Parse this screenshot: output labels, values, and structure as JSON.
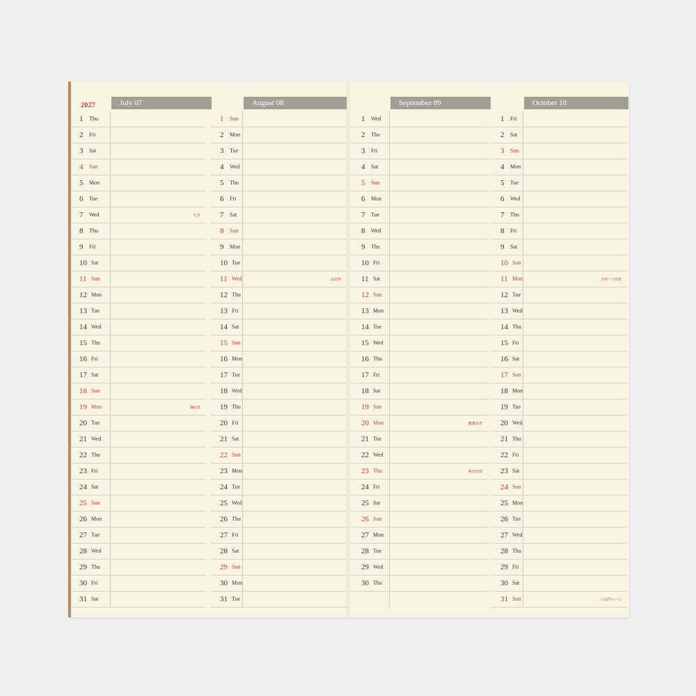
{
  "year": "2027",
  "months": [
    {
      "name": "July 07",
      "days": [
        {
          "n": "1",
          "w": "Thu"
        },
        {
          "n": "2",
          "w": "Fri"
        },
        {
          "n": "3",
          "w": "Sat"
        },
        {
          "n": "4",
          "w": "Sun",
          "red": true
        },
        {
          "n": "5",
          "w": "Mon"
        },
        {
          "n": "6",
          "w": "Tue"
        },
        {
          "n": "7",
          "w": "Wed",
          "note": "七夕"
        },
        {
          "n": "8",
          "w": "Thu"
        },
        {
          "n": "9",
          "w": "Fri"
        },
        {
          "n": "10",
          "w": "Sat"
        },
        {
          "n": "11",
          "w": "Sun",
          "red": true
        },
        {
          "n": "12",
          "w": "Mon"
        },
        {
          "n": "13",
          "w": "Tue"
        },
        {
          "n": "14",
          "w": "Wed"
        },
        {
          "n": "15",
          "w": "Thu"
        },
        {
          "n": "16",
          "w": "Fri"
        },
        {
          "n": "17",
          "w": "Sat"
        },
        {
          "n": "18",
          "w": "Sun",
          "red": true
        },
        {
          "n": "19",
          "w": "Mon",
          "red": true,
          "note": "海の日"
        },
        {
          "n": "20",
          "w": "Tue"
        },
        {
          "n": "21",
          "w": "Wed"
        },
        {
          "n": "22",
          "w": "Thu"
        },
        {
          "n": "23",
          "w": "Fri"
        },
        {
          "n": "24",
          "w": "Sat"
        },
        {
          "n": "25",
          "w": "Sun",
          "red": true
        },
        {
          "n": "26",
          "w": "Mon"
        },
        {
          "n": "27",
          "w": "Tue"
        },
        {
          "n": "28",
          "w": "Wed"
        },
        {
          "n": "29",
          "w": "Thu"
        },
        {
          "n": "30",
          "w": "Fri"
        },
        {
          "n": "31",
          "w": "Sat"
        }
      ]
    },
    {
      "name": "August 08",
      "days": [
        {
          "n": "1",
          "w": "Sun",
          "red": true
        },
        {
          "n": "2",
          "w": "Mon"
        },
        {
          "n": "3",
          "w": "Tue"
        },
        {
          "n": "4",
          "w": "Wed"
        },
        {
          "n": "5",
          "w": "Thu"
        },
        {
          "n": "6",
          "w": "Fri"
        },
        {
          "n": "7",
          "w": "Sat"
        },
        {
          "n": "8",
          "w": "Sun",
          "red": true
        },
        {
          "n": "9",
          "w": "Mon"
        },
        {
          "n": "10",
          "w": "Tue"
        },
        {
          "n": "11",
          "w": "Wed",
          "red": true,
          "note": "山の日"
        },
        {
          "n": "12",
          "w": "Thu"
        },
        {
          "n": "13",
          "w": "Fri"
        },
        {
          "n": "14",
          "w": "Sat"
        },
        {
          "n": "15",
          "w": "Sun",
          "red": true
        },
        {
          "n": "16",
          "w": "Mon"
        },
        {
          "n": "17",
          "w": "Tue"
        },
        {
          "n": "18",
          "w": "Wed"
        },
        {
          "n": "19",
          "w": "Thu"
        },
        {
          "n": "20",
          "w": "Fri"
        },
        {
          "n": "21",
          "w": "Sat"
        },
        {
          "n": "22",
          "w": "Sun",
          "red": true
        },
        {
          "n": "23",
          "w": "Mon"
        },
        {
          "n": "24",
          "w": "Tue"
        },
        {
          "n": "25",
          "w": "Wed"
        },
        {
          "n": "26",
          "w": "Thu"
        },
        {
          "n": "27",
          "w": "Fri"
        },
        {
          "n": "28",
          "w": "Sat"
        },
        {
          "n": "29",
          "w": "Sun",
          "red": true
        },
        {
          "n": "30",
          "w": "Mon"
        },
        {
          "n": "31",
          "w": "Tue"
        }
      ]
    },
    {
      "name": "September 09",
      "days": [
        {
          "n": "1",
          "w": "Wed"
        },
        {
          "n": "2",
          "w": "Thu"
        },
        {
          "n": "3",
          "w": "Fri"
        },
        {
          "n": "4",
          "w": "Sat"
        },
        {
          "n": "5",
          "w": "Sun",
          "red": true
        },
        {
          "n": "6",
          "w": "Mon"
        },
        {
          "n": "7",
          "w": "Tue"
        },
        {
          "n": "8",
          "w": "Wed"
        },
        {
          "n": "9",
          "w": "Thu"
        },
        {
          "n": "10",
          "w": "Fri"
        },
        {
          "n": "11",
          "w": "Sat"
        },
        {
          "n": "12",
          "w": "Sun",
          "red": true
        },
        {
          "n": "13",
          "w": "Mon"
        },
        {
          "n": "14",
          "w": "Tue"
        },
        {
          "n": "15",
          "w": "Wed"
        },
        {
          "n": "16",
          "w": "Thu"
        },
        {
          "n": "17",
          "w": "Fri"
        },
        {
          "n": "18",
          "w": "Sat"
        },
        {
          "n": "19",
          "w": "Sun",
          "red": true
        },
        {
          "n": "20",
          "w": "Mon",
          "red": true,
          "note": "敬老の日"
        },
        {
          "n": "21",
          "w": "Tue"
        },
        {
          "n": "22",
          "w": "Wed"
        },
        {
          "n": "23",
          "w": "Thu",
          "red": true,
          "note": "秋分の日"
        },
        {
          "n": "24",
          "w": "Fri"
        },
        {
          "n": "25",
          "w": "Sat"
        },
        {
          "n": "26",
          "w": "Sun",
          "red": true
        },
        {
          "n": "27",
          "w": "Mon"
        },
        {
          "n": "28",
          "w": "Tue"
        },
        {
          "n": "29",
          "w": "Wed"
        },
        {
          "n": "30",
          "w": "Thu"
        }
      ]
    },
    {
      "name": "October 10",
      "days": [
        {
          "n": "1",
          "w": "Fri"
        },
        {
          "n": "2",
          "w": "Sat"
        },
        {
          "n": "3",
          "w": "Sun",
          "red": true
        },
        {
          "n": "4",
          "w": "Mon"
        },
        {
          "n": "5",
          "w": "Tue"
        },
        {
          "n": "6",
          "w": "Wed"
        },
        {
          "n": "7",
          "w": "Thu"
        },
        {
          "n": "8",
          "w": "Fri"
        },
        {
          "n": "9",
          "w": "Sat"
        },
        {
          "n": "10",
          "w": "Sun",
          "red": true
        },
        {
          "n": "11",
          "w": "Mon",
          "red": true,
          "note": "スポーツの日"
        },
        {
          "n": "12",
          "w": "Tue"
        },
        {
          "n": "13",
          "w": "Wed"
        },
        {
          "n": "14",
          "w": "Thu"
        },
        {
          "n": "15",
          "w": "Fri"
        },
        {
          "n": "16",
          "w": "Sat"
        },
        {
          "n": "17",
          "w": "Sun",
          "red": true
        },
        {
          "n": "18",
          "w": "Mon"
        },
        {
          "n": "19",
          "w": "Tue"
        },
        {
          "n": "20",
          "w": "Wed"
        },
        {
          "n": "21",
          "w": "Thu"
        },
        {
          "n": "22",
          "w": "Fri"
        },
        {
          "n": "23",
          "w": "Sat"
        },
        {
          "n": "24",
          "w": "Sun",
          "red": true
        },
        {
          "n": "25",
          "w": "Mon"
        },
        {
          "n": "26",
          "w": "Tue"
        },
        {
          "n": "27",
          "w": "Wed"
        },
        {
          "n": "28",
          "w": "Thu"
        },
        {
          "n": "29",
          "w": "Fri"
        },
        {
          "n": "30",
          "w": "Sat"
        },
        {
          "n": "31",
          "w": "Sun",
          "red": true,
          "note": "ハロウィーン",
          "noteGrey": false
        }
      ]
    }
  ],
  "colors": {
    "accent_red": "#c0364e",
    "header_grey": "#a19e96",
    "paper": "#f7f4e4"
  }
}
